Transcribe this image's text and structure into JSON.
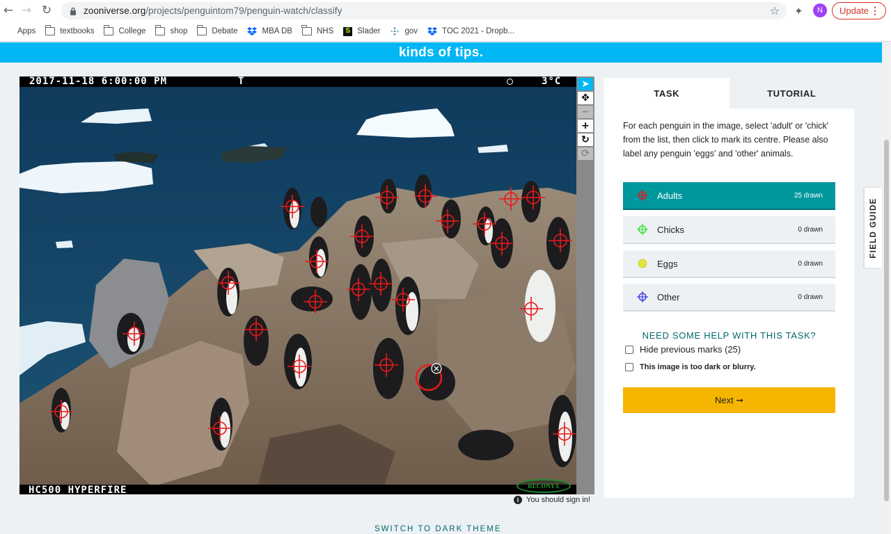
{
  "browser": {
    "url_host": "zooniverse.org",
    "url_path": "/projects/penguintom79/penguin-watch/classify",
    "avatar_letter": "N",
    "update_label": "Update"
  },
  "bookmarks": [
    {
      "label": "Apps",
      "icon": "apps-grid-icon"
    },
    {
      "label": "textbooks",
      "icon": "folder-icon"
    },
    {
      "label": "College",
      "icon": "folder-icon"
    },
    {
      "label": "shop",
      "icon": "folder-icon"
    },
    {
      "label": "Debate",
      "icon": "folder-icon"
    },
    {
      "label": "MBA DB",
      "icon": "dropbox-icon"
    },
    {
      "label": "NHS",
      "icon": "folder-icon"
    },
    {
      "label": "Slader",
      "icon": "slader-icon"
    },
    {
      "label": "gov",
      "icon": "gov-icon"
    },
    {
      "label": "TOC 2021 - Dropb...",
      "icon": "dropbox-icon"
    }
  ],
  "banner_text": "kinds of tips.",
  "camera": {
    "timestamp": "2017-11-18  6:00:00 PM",
    "flag": "T",
    "temperature": "3°C",
    "model": "HC500 HYPERFIRE",
    "brand": "RECONYX"
  },
  "tools": [
    "pointer-icon",
    "move-icon",
    "zoom-out-icon",
    "zoom-in-icon",
    "rotate-icon",
    "reset-icon"
  ],
  "signin_text": "You should sign in!",
  "panel": {
    "tab_task": "TASK",
    "tab_tutorial": "TUTORIAL",
    "instructions": "For each penguin in the image, select 'adult' or 'chick' from the list, then click to mark its centre. Please also label any penguin 'eggs' and 'other' animals.",
    "choices": [
      {
        "label": "Adults",
        "count": "25 drawn",
        "color": "#e8191b",
        "selected": true
      },
      {
        "label": "Chicks",
        "count": "0 drawn",
        "color": "#35e33c",
        "selected": false
      },
      {
        "label": "Eggs",
        "count": "0 drawn",
        "color": "#e3e33c",
        "selected": false
      },
      {
        "label": "Other",
        "count": "0 drawn",
        "color": "#3c3ce3",
        "selected": false
      }
    ],
    "help_text": "NEED SOME HELP WITH THIS TASK?",
    "hide_marks_label": "Hide previous marks (25)",
    "too_dark_label": "This image is too dark or blurry.",
    "next_label": "Next ➞"
  },
  "field_guide_label": "FIELD GUIDE",
  "dark_theme_label": "SWITCH TO DARK THEME",
  "colors": {
    "banner": "#00b6f3",
    "selected_tool": "#00979d",
    "next_button": "#f6b500",
    "mark_red": "#e8191b"
  }
}
